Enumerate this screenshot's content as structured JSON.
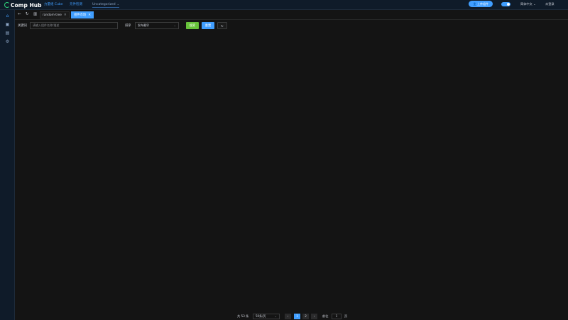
{
  "app": {
    "name": "Comp Hub"
  },
  "topnav": [
    {
      "label": "力量组 Cube"
    },
    {
      "label": "元件检测"
    },
    {
      "label": "Uncategorized"
    }
  ],
  "header": {
    "upload_label": "上传组件",
    "language": "简体中文",
    "user": "未登录"
  },
  "tabs": [
    {
      "label": "random-tree"
    },
    {
      "label": "组件市场"
    }
  ],
  "filters": {
    "keyword_label": "关键词",
    "keyword_placeholder": "请输入组件名称/描述",
    "sort_label": "排序",
    "sort_value": "发布最早",
    "search_label": "搜索",
    "reset_label": "重置"
  },
  "pagination": {
    "total": "共 53 条",
    "page_size": "50条/页",
    "pages": [
      "1",
      "2"
    ],
    "goto_label": "前往",
    "current": "1",
    "unit": "页"
  },
  "colors": {
    "accent": "#409eff",
    "success": "#67c23a",
    "background": "#141414",
    "header_bg": "#0f1b29"
  }
}
